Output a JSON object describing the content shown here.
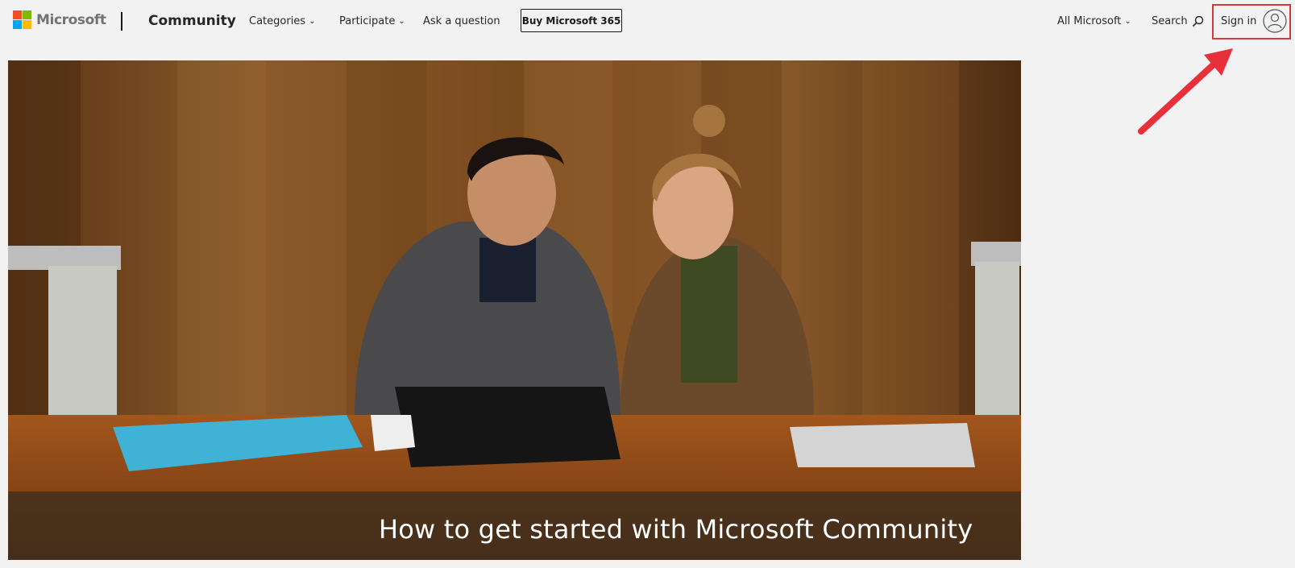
{
  "brand": {
    "name": "Microsoft",
    "product": "Community",
    "colors": {
      "red": "#f25022",
      "green": "#7fba00",
      "blue": "#00a4ef",
      "yellow": "#ffb900"
    }
  },
  "nav": {
    "categories": "Categories",
    "participate": "Participate",
    "ask": "Ask a question",
    "buy": "Buy Microsoft 365"
  },
  "right_nav": {
    "all_microsoft": "All Microsoft",
    "search": "Search",
    "sign_in": "Sign in"
  },
  "icons": {
    "dropdown": "chevron-down-icon",
    "search": "search-icon",
    "account": "person-icon"
  },
  "hero": {
    "caption": "How to get started with Microsoft Community"
  },
  "annotation": {
    "highlight_color": "#d9363e"
  }
}
